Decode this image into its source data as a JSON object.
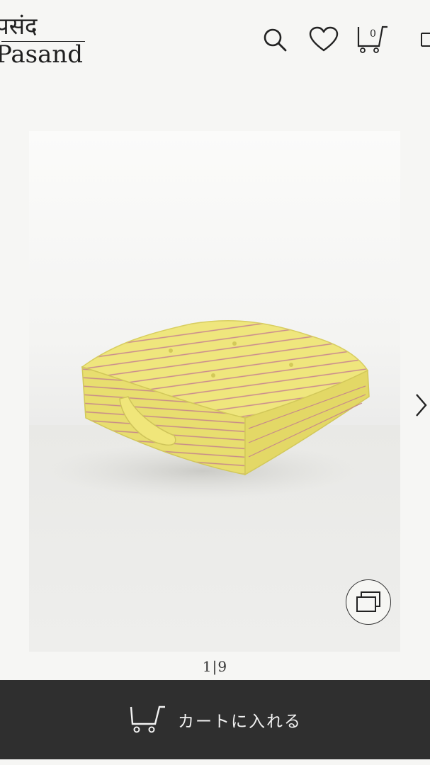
{
  "header": {
    "logo_top": "पसंद",
    "logo_bottom": "Pasand",
    "cart_count": "0",
    "icons": [
      "search-icon",
      "heart-icon",
      "cart-icon",
      "menu-icon"
    ]
  },
  "gallery": {
    "current": "1",
    "separator": "|",
    "total": "9",
    "product_color": "#eee47a",
    "stripe_color": "#c98a8e"
  },
  "actions": {
    "add_to_cart_label": "カートに入れる"
  },
  "colors": {
    "bar_background": "#2f2f2f",
    "bar_text": "#f2f2f2",
    "page_background": "#f6f6f4"
  }
}
